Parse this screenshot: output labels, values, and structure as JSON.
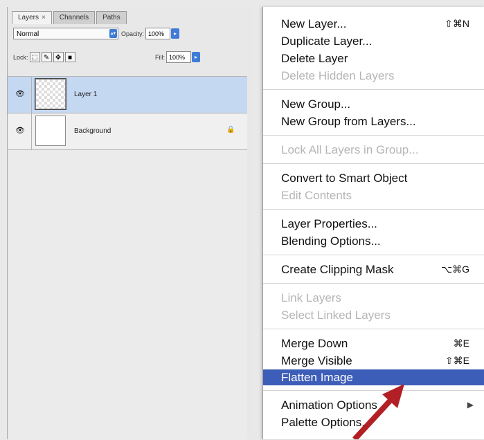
{
  "panel": {
    "tabs": [
      {
        "label": "Layers",
        "close": "×"
      },
      {
        "label": "Channels"
      },
      {
        "label": "Paths"
      }
    ],
    "blend_mode": "Normal",
    "opacity_label": "Opacity:",
    "opacity_value": "100%",
    "lock_label": "Lock:",
    "fill_label": "Fill:",
    "fill_value": "100%"
  },
  "layers": [
    {
      "name": "Layer 1",
      "selected": true
    },
    {
      "name": "Background",
      "locked": true
    }
  ],
  "menu": {
    "items": [
      {
        "label": "New Layer...",
        "shortcut": "⇧⌘N"
      },
      {
        "label": "Duplicate Layer..."
      },
      {
        "label": "Delete Layer"
      },
      {
        "label": "Delete Hidden Layers",
        "disabled": true
      },
      {
        "label": "New Group..."
      },
      {
        "label": "New Group from Layers..."
      },
      {
        "label": "Lock All Layers in Group...",
        "disabled": true
      },
      {
        "label": "Convert to Smart Object"
      },
      {
        "label": "Edit Contents",
        "disabled": true
      },
      {
        "label": "Layer Properties..."
      },
      {
        "label": "Blending Options..."
      },
      {
        "label": "Create Clipping Mask",
        "shortcut": "⌥⌘G"
      },
      {
        "label": "Link Layers",
        "disabled": true
      },
      {
        "label": "Select Linked Layers",
        "disabled": true
      },
      {
        "label": "Merge Down",
        "shortcut": "⌘E"
      },
      {
        "label": "Merge Visible",
        "shortcut": "⇧⌘E"
      },
      {
        "label": "Flatten Image",
        "highlighted": true
      },
      {
        "label": "Animation Options",
        "submenu": "▶"
      },
      {
        "label": "Palette Options..."
      }
    ]
  },
  "colors": {
    "highlight": "#3d5eb8",
    "selected_layer": "#c5d8f2",
    "arrow": "#b21f24"
  }
}
